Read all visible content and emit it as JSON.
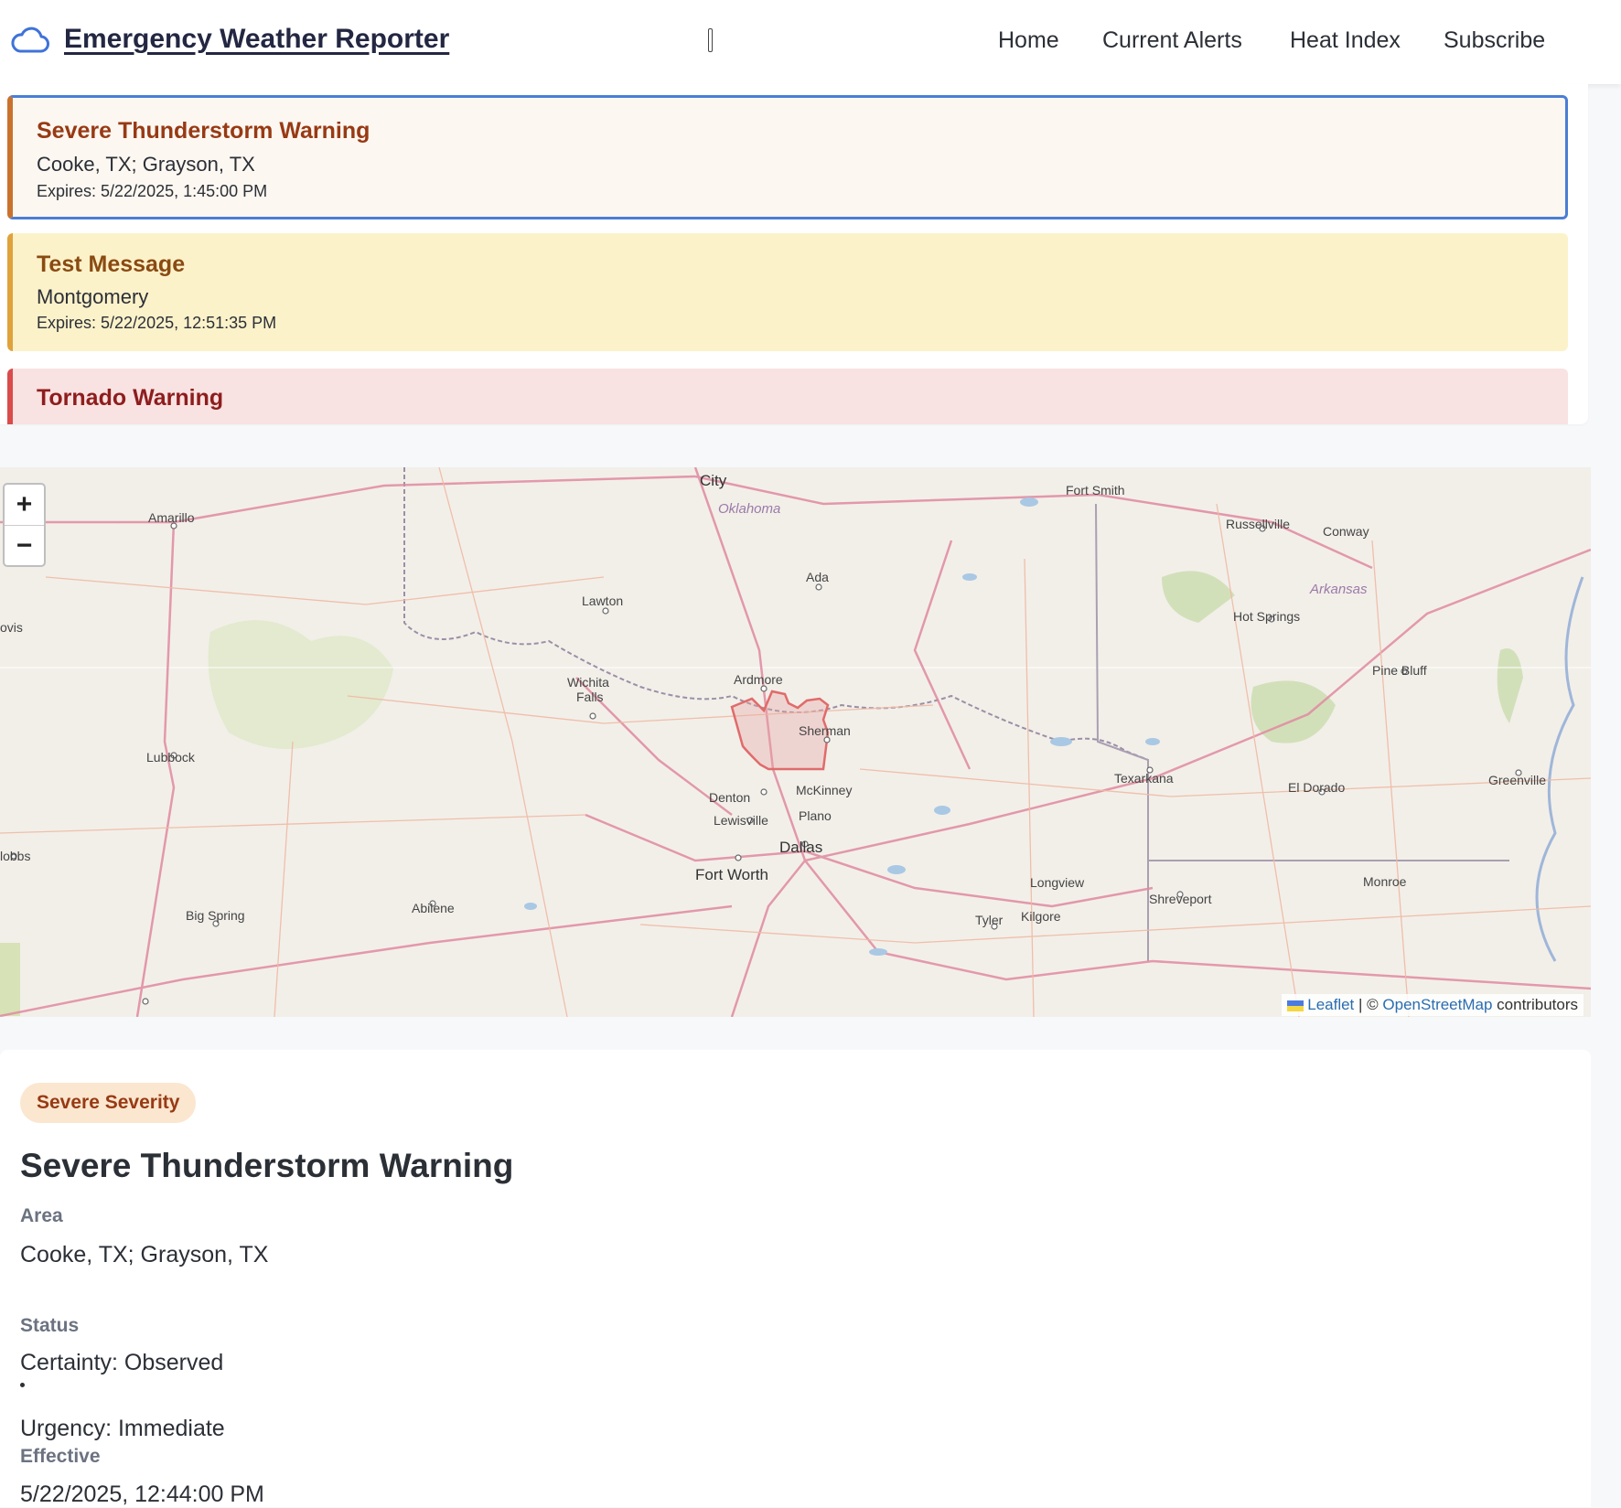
{
  "header": {
    "title": "Emergency Weather Reporter",
    "logo_icon": "cloud-icon",
    "nav": [
      "Home",
      "Current Alerts",
      "Heat Index",
      "Subscribe"
    ]
  },
  "alerts": [
    {
      "title": "Severe Thunderstorm Warning",
      "area": "Cooke, TX; Grayson, TX",
      "expires": "Expires: 5/22/2025, 1:45:00 PM",
      "selected": true
    },
    {
      "title": "Test Message",
      "area": "Montgomery",
      "expires": "Expires: 5/22/2025, 12:51:35 PM"
    },
    {
      "title": "Tornado Warning"
    }
  ],
  "map": {
    "zoom_in": "+",
    "zoom_out": "−",
    "labels": {
      "city_top": "City",
      "oklahoma": "Oklahoma",
      "fort_smith": "Fort Smith",
      "amarillo": "Amarillo",
      "russellville": "Russellville",
      "conway": "Conway",
      "ada": "Ada",
      "lawton": "Lawton",
      "arkansas": "Arkansas",
      "hot_springs": "Hot Springs",
      "clovis": "ovis",
      "pine_bluff": "Pine Bluff",
      "ardmore": "Ardmore",
      "wichita1": "Wichita",
      "wichita2": "Falls",
      "sherman": "Sherman",
      "lubbock": "Lubbock",
      "texarkana": "Texarkana",
      "el_dorado": "El Dorado",
      "greenville": "Greenville",
      "denton": "Denton",
      "mckinney": "McKinney",
      "plano": "Plano",
      "lewisville": "Lewisville",
      "dallas": "Dallas",
      "hobbs": "lobbs",
      "fort_worth": "Fort Worth",
      "longview": "Longview",
      "monroe": "Monroe",
      "shreveport": "Shreveport",
      "abilene": "Abilene",
      "big_spring": "Big Spring",
      "tyler": "Tyler",
      "kilgore": "Kilgore"
    },
    "attribution": {
      "leaflet": "Leaflet",
      "sep": "| ©",
      "osm": "OpenStreetMap",
      "contributors": "contributors"
    }
  },
  "details": {
    "severity_badge": "Severe Severity",
    "title": "Severe Thunderstorm Warning",
    "area_label": "Area",
    "area_value": "Cooke, TX; Grayson, TX",
    "status_label": "Status",
    "certainty": "Certainty: Observed",
    "urgency": "Urgency: Immediate",
    "effective_label": "Effective",
    "effective_value": "5/22/2025, 12:44:00 PM"
  },
  "colors": {
    "accent": "#4a7ed6",
    "severe": "#973a14",
    "test": "#e0a23a",
    "tornado": "#d94c4c"
  }
}
